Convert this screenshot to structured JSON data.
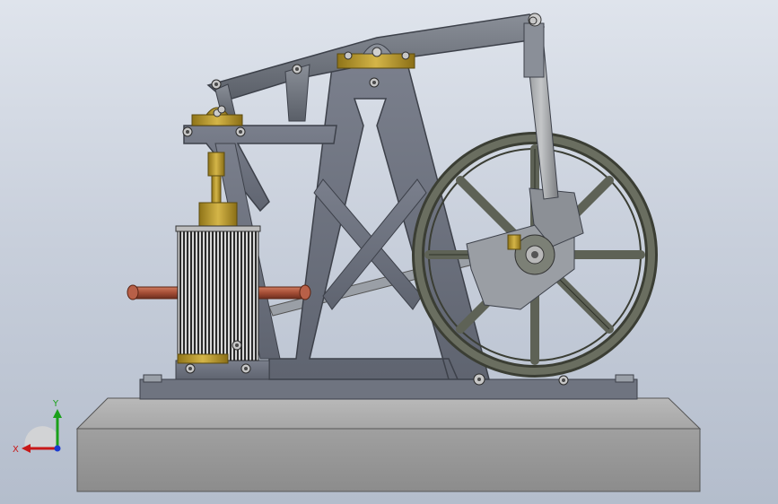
{
  "viewport": {
    "background_top": "#dfe4ec",
    "background_bottom": "#b4bdcc"
  },
  "model": {
    "frame_color": "#6e7380",
    "frame_edge": "#3d414a",
    "brass_color": "#b99a2c",
    "copper_color": "#b05a40",
    "base_color": "#a4a4a4",
    "flywheel_color": "#5a5e52"
  },
  "triad": {
    "x_label": "X",
    "y_label": "Y",
    "x_color": "#c81818",
    "y_color": "#1aa01a",
    "z_color": "#1a3ad0"
  }
}
